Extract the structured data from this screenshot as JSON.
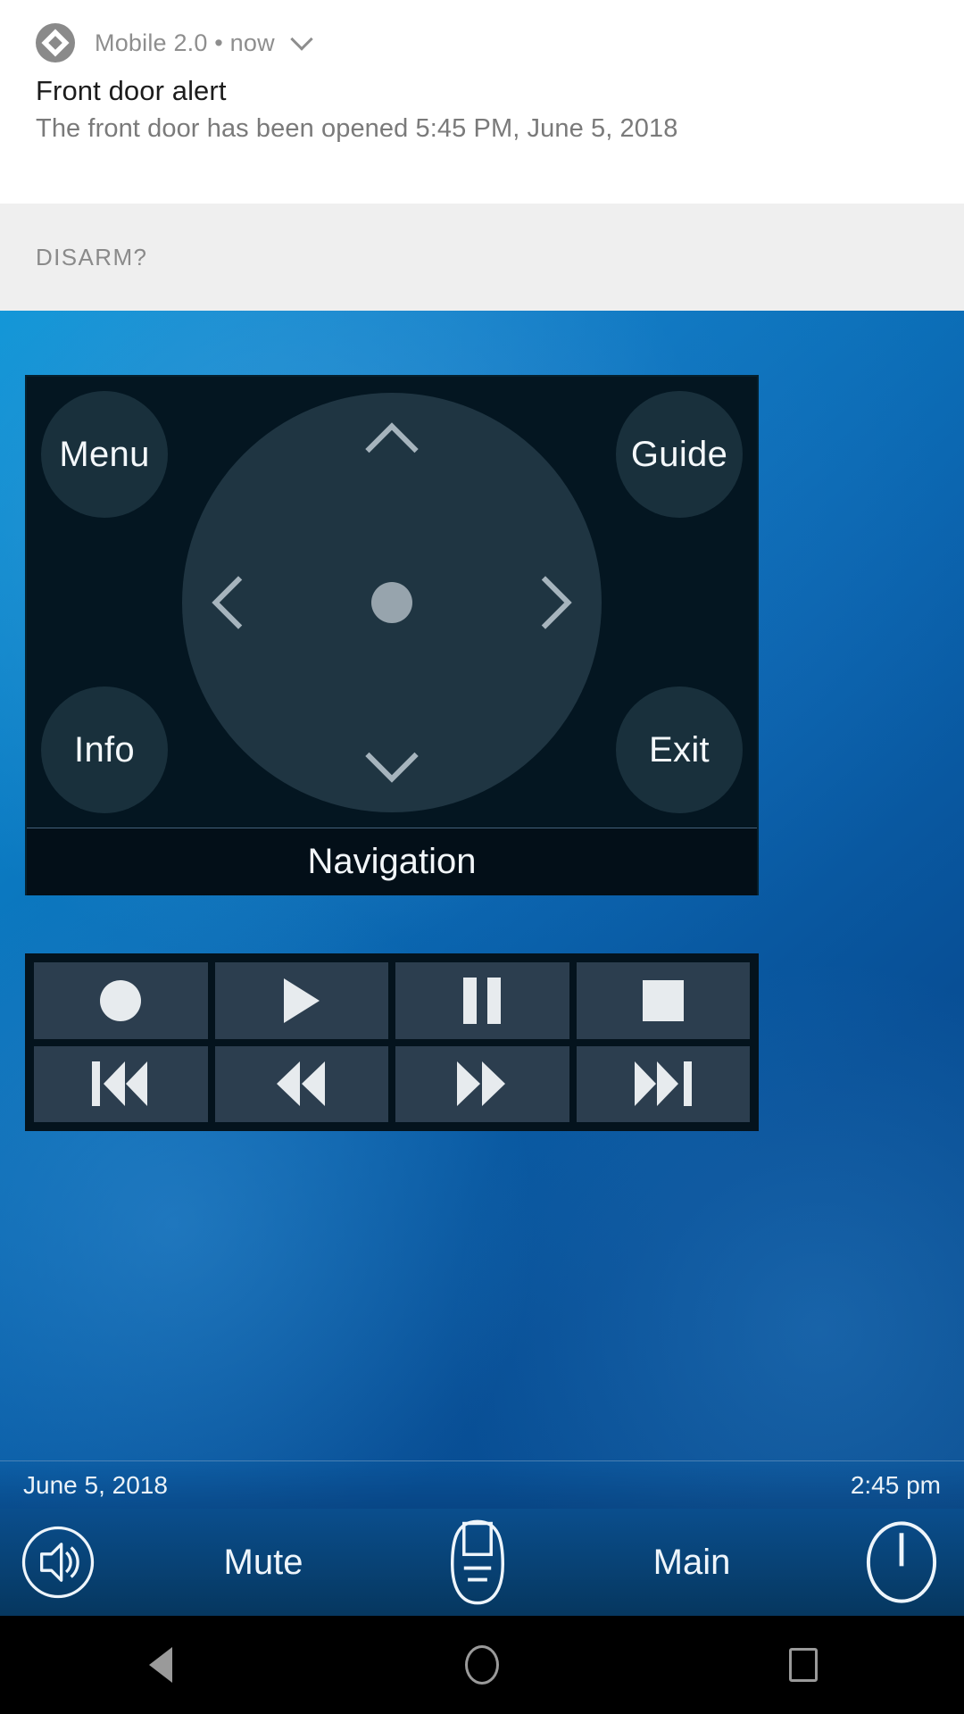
{
  "notification": {
    "app_icon": "compass-logo-icon",
    "app_name": "Mobile 2.0",
    "separator": "•",
    "time_ago": "now",
    "expand_icon": "chevron-down-icon",
    "title": "Front door alert",
    "body": "The front door has been opened 5:45 PM, June 5, 2018"
  },
  "disarm": {
    "label": "DISARM?"
  },
  "color_row": {
    "buttons": [
      {
        "name": "red-button",
        "color": "#7a1f1f"
      },
      {
        "name": "green-button",
        "color": "#2e6b24"
      },
      {
        "name": "yellow-button",
        "color": "#6e671d"
      },
      {
        "name": "blue-button",
        "color": "#2c3d89"
      }
    ]
  },
  "navigation": {
    "caption": "Navigation",
    "corner_buttons": {
      "menu": "Menu",
      "guide": "Guide",
      "info": "Info",
      "exit": "Exit"
    },
    "dpad": {
      "up_icon": "chevron-up-icon",
      "down_icon": "chevron-down-icon",
      "left_icon": "chevron-left-icon",
      "right_icon": "chevron-right-icon",
      "ok_icon": "center-ok-dot-icon"
    }
  },
  "transport": {
    "buttons": [
      {
        "name": "record-button",
        "icon": "record-icon"
      },
      {
        "name": "play-button",
        "icon": "play-icon"
      },
      {
        "name": "pause-button",
        "icon": "pause-icon"
      },
      {
        "name": "stop-button",
        "icon": "stop-icon"
      },
      {
        "name": "skip-previous-button",
        "icon": "skip-previous-icon"
      },
      {
        "name": "rewind-button",
        "icon": "rewind-icon"
      },
      {
        "name": "fast-forward-button",
        "icon": "fast-forward-icon"
      },
      {
        "name": "skip-next-button",
        "icon": "skip-next-icon"
      }
    ]
  },
  "status_bar": {
    "date": "June 5, 2018",
    "time": "2:45 pm"
  },
  "toolbar": {
    "volume_icon": "volume-icon",
    "mute_label": "Mute",
    "keypad_icon": "remote-keypad-icon",
    "main_label": "Main",
    "power_icon": "power-icon"
  },
  "system_nav": {
    "back_icon": "back-triangle-icon",
    "home_icon": "home-circle-icon",
    "recents_icon": "recents-square-icon"
  },
  "colors": {
    "accent_blue": "#0a63ad",
    "panel_dark": "#041621",
    "transport_button": "#2c3e4f",
    "glyph_white": "#e7ebee"
  }
}
